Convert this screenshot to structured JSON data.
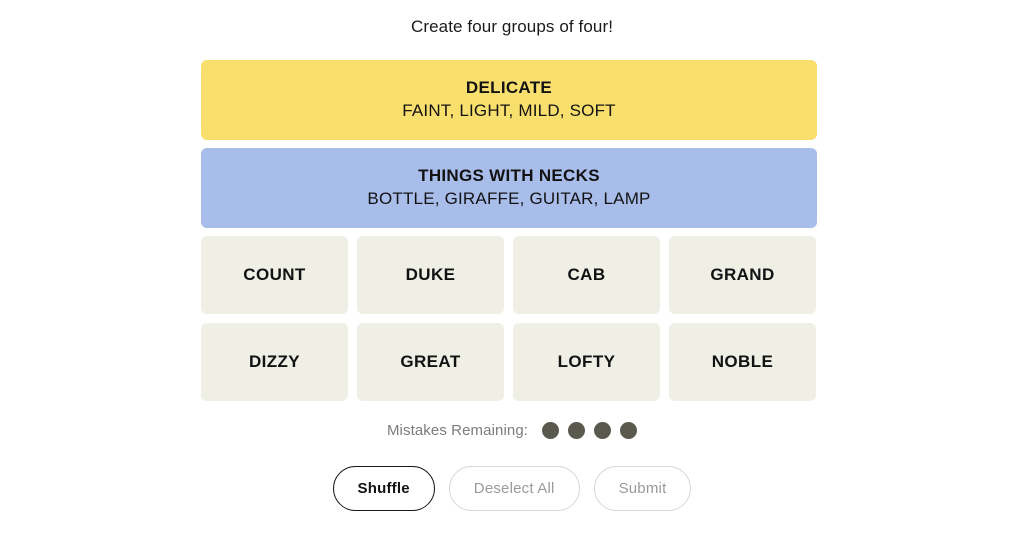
{
  "header": {
    "instruction": "Create four groups of four!"
  },
  "solved_groups": [
    {
      "category": "DELICATE",
      "members": "FAINT, LIGHT, MILD, SOFT",
      "color": "#F9DF6D"
    },
    {
      "category": "THINGS WITH NECKS",
      "members": "BOTTLE, GIRAFFE, GUITAR, LAMP",
      "color": "#A9BDEB"
    }
  ],
  "tiles": [
    {
      "label": "COUNT"
    },
    {
      "label": "DUKE"
    },
    {
      "label": "CAB"
    },
    {
      "label": "GRAND"
    },
    {
      "label": "DIZZY"
    },
    {
      "label": "GREAT"
    },
    {
      "label": "LOFTY"
    },
    {
      "label": "NOBLE"
    }
  ],
  "tile_color": "#EFEFE6",
  "mistakes": {
    "label": "Mistakes Remaining:",
    "remaining": 4,
    "dot_color": "#5A594E"
  },
  "actions": {
    "shuffle": "Shuffle",
    "deselect": "Deselect All",
    "submit": "Submit"
  }
}
